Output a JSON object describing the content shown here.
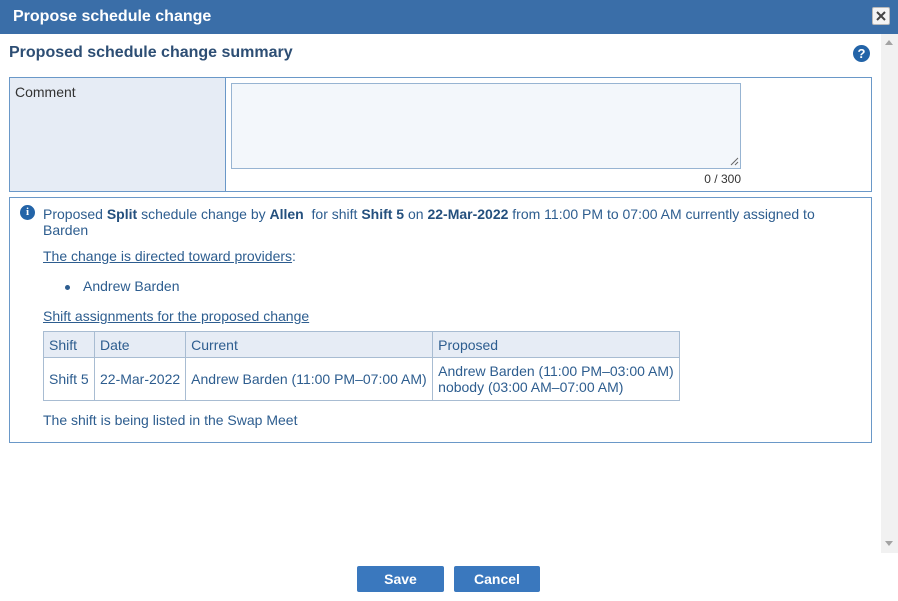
{
  "dialog": {
    "title": "Propose schedule change",
    "close_icon": "close-icon"
  },
  "summary": {
    "heading": "Proposed schedule change summary",
    "help_icon": "question-icon",
    "help_glyph": "?"
  },
  "comment": {
    "label": "Comment",
    "value": "",
    "placeholder": "",
    "char_count": "0 / 300"
  },
  "info": {
    "icon_glyph": "i",
    "text_proposed": "Proposed",
    "change_type": "Split",
    "text_by": "schedule change by",
    "author": "Allen",
    "text_for_shift": "for shift",
    "shift": "Shift 5",
    "text_on": "on",
    "date": "22-Mar-2022",
    "text_from": "from 11:00 PM to 07:00 AM  currently assigned to Barden",
    "directed_link": "The change is directed toward providers",
    "colon": ":",
    "providers": [
      "Andrew Barden"
    ],
    "assignments_link": "Shift assignments for the proposed change",
    "swap_text": "The shift is being listed in the Swap Meet"
  },
  "table": {
    "headers": [
      "Shift",
      "Date",
      "Current",
      "Proposed"
    ],
    "rows": [
      {
        "shift": "Shift 5",
        "date": "22-Mar-2022",
        "current": "Andrew Barden (11:00 PM–07:00 AM)",
        "proposed_1": "Andrew Barden (11:00 PM–03:00 AM)",
        "proposed_2": "nobody (03:00 AM–07:00 AM)"
      }
    ]
  },
  "buttons": {
    "save": "Save",
    "cancel": "Cancel"
  },
  "colors": {
    "titlebar": "#3a6ea8",
    "accent": "#2364a8",
    "button": "#3a78be",
    "text_blue": "#2d5d8f"
  }
}
